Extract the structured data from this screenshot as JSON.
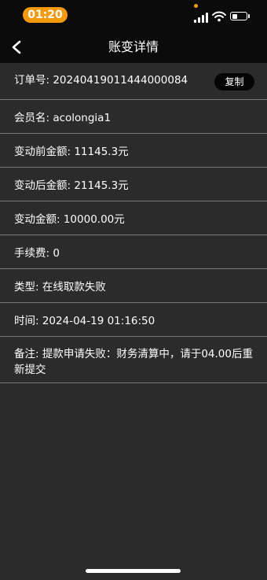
{
  "status_bar": {
    "time": "01:20"
  },
  "nav": {
    "title": "账变详情",
    "back_icon": "chevron-left-icon"
  },
  "details": {
    "order_no": "订单号: 20240419011444000084",
    "copy_label": "复制",
    "member": "会员名: acolongia1",
    "before_amount": "变动前金额: 11145.3元",
    "after_amount": "变动后金额: 21145.3元",
    "change_amount": "变动金额: 10000.00元",
    "fee": "手续费: 0",
    "type": "类型: 在线取款失败",
    "time": "时间: 2024-04-19 01:16:50",
    "remark": "备注: 提款申请失败：财务清算中，请于04.00后重新提交"
  },
  "colors": {
    "accent": "#f49a0a",
    "background": "#2b2b2b",
    "bar": "#0b0b0b",
    "divider": "#777777"
  }
}
